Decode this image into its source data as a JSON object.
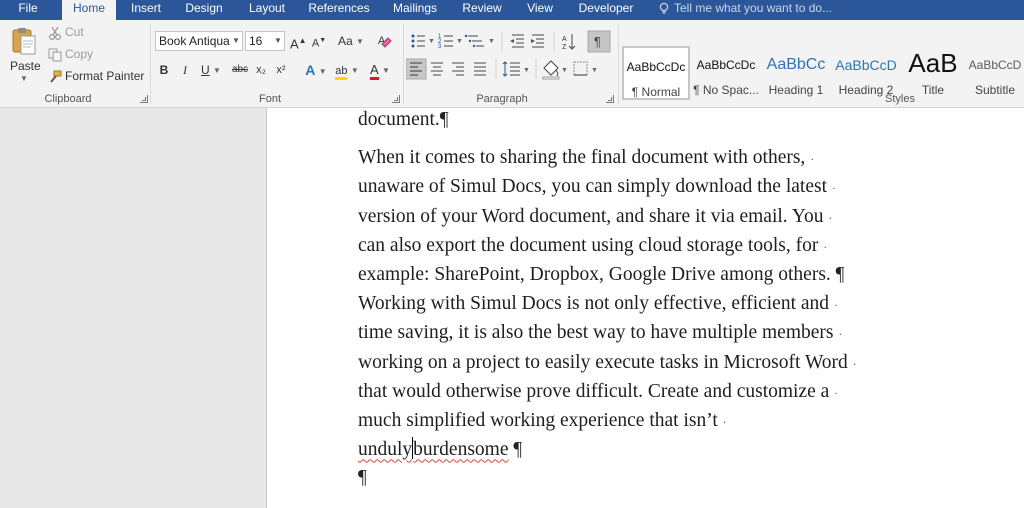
{
  "tabs": [
    "File",
    "Home",
    "Insert",
    "Design",
    "Layout",
    "References",
    "Mailings",
    "Review",
    "View",
    "Developer"
  ],
  "tell_me": "Tell me what you want to do...",
  "clipboard": {
    "paste": "Paste",
    "cut": "Cut",
    "copy": "Copy",
    "format_painter": "Format Painter",
    "group_label": "Clipboard"
  },
  "font": {
    "name": "Book Antiqua",
    "size": "16",
    "grow": "A",
    "shrink": "A",
    "change_case": "Aa",
    "bold": "B",
    "italic": "I",
    "underline": "U",
    "strike": "abc",
    "subscript": "x₂",
    "superscript": "x²",
    "effects": "A",
    "highlight": "ab",
    "color": "A",
    "group_label": "Font"
  },
  "paragraph": {
    "show_marks": "¶",
    "group_label": "Paragraph"
  },
  "styles": {
    "items": [
      {
        "preview": "AaBbCcDc",
        "name": "¶ Normal"
      },
      {
        "preview": "AaBbCcDc",
        "name": "¶ No Spac..."
      },
      {
        "preview": "AaBbCc",
        "name": "Heading 1"
      },
      {
        "preview": "AaBbCcD",
        "name": "Heading 2"
      },
      {
        "preview": "AaB",
        "name": "Title"
      },
      {
        "preview": "AaBbCcD",
        "name": "Subtitle"
      }
    ],
    "group_label": "Styles"
  },
  "colors": {
    "accent": "#2b579a",
    "heading": "#2e74b5",
    "font_color": "#e81123",
    "highlight": "#ffd600"
  },
  "document": {
    "top_line": "document.",
    "pilcrow": "¶",
    "para1": [
      "When it comes to sharing the final document with others, ",
      "unaware of Simul Docs, you can simply download the latest ",
      "version of your Word document, and share it via email. You ",
      "can also export the document using cloud storage tools, for ",
      "example: SharePoint, Dropbox, Google Drive among others. "
    ],
    "para2": [
      " Working with Simul Docs is not only effective, efficient and ",
      "time saving, it is also the best way to have multiple members ",
      "working on a project to easily execute tasks in Microsoft Word ",
      "that would otherwise prove difficult. Create and customize a ",
      "much simplified working experience that isn’t "
    ],
    "last_word_a": "unduly",
    "last_word_b": "burdensome",
    "space_dot": "·"
  }
}
